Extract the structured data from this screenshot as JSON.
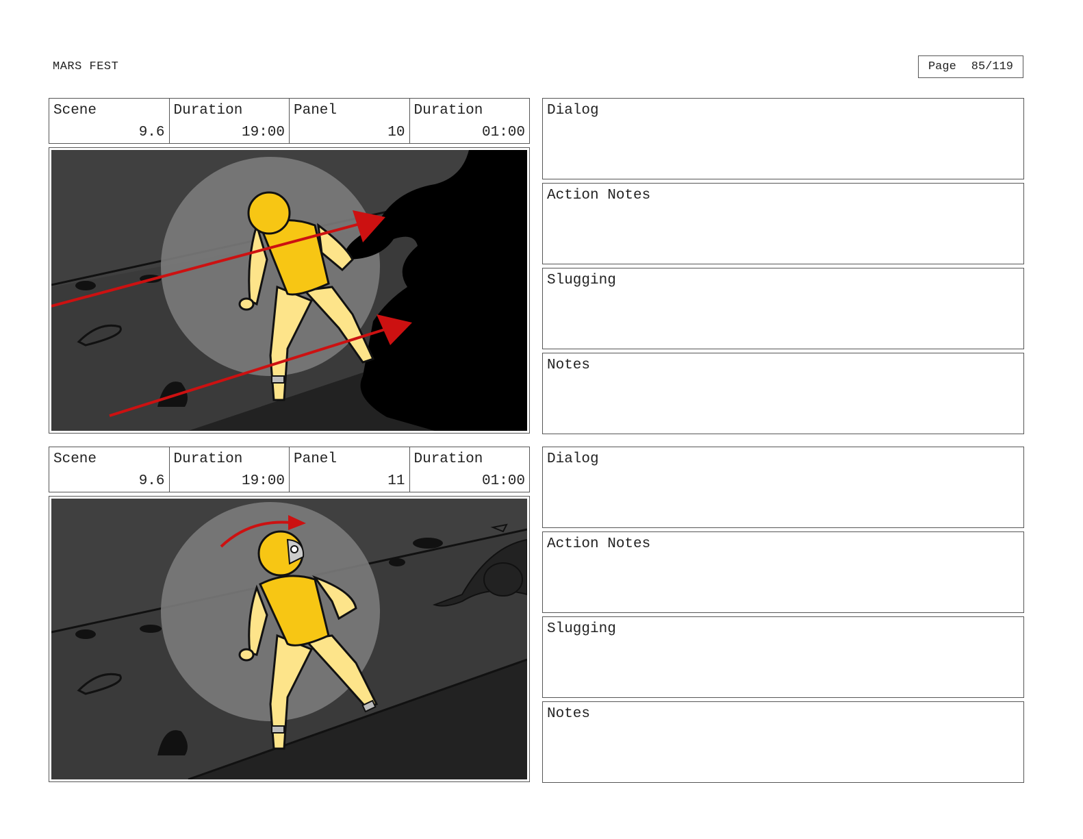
{
  "header": {
    "project_title": "MARS FEST",
    "page_label": "Page",
    "page_number": "85/119"
  },
  "panels": [
    {
      "scene_label": "Scene",
      "scene_value": "9.6",
      "duration_label": "Duration",
      "duration_value": "19:00",
      "panel_label": "Panel",
      "panel_value": "10",
      "panel_duration_label": "Duration",
      "panel_duration_value": "01:00",
      "dialog_label": "Dialog",
      "action_notes_label": "Action Notes",
      "slugging_label": "Slugging",
      "notes_label": "Notes"
    },
    {
      "scene_label": "Scene",
      "scene_value": "9.6",
      "duration_label": "Duration",
      "duration_value": "19:00",
      "panel_label": "Panel",
      "panel_value": "11",
      "panel_duration_label": "Duration",
      "panel_duration_value": "01:00",
      "dialog_label": "Dialog",
      "action_notes_label": "Action Notes",
      "slugging_label": "Slugging",
      "notes_label": "Notes"
    }
  ],
  "colors": {
    "suit_yellow": "#f7c614",
    "suit_light": "#fde48a",
    "ground_dark": "#3a3a3a",
    "spotlight": "#7b7b7b",
    "arrow_red": "#cc1111"
  }
}
